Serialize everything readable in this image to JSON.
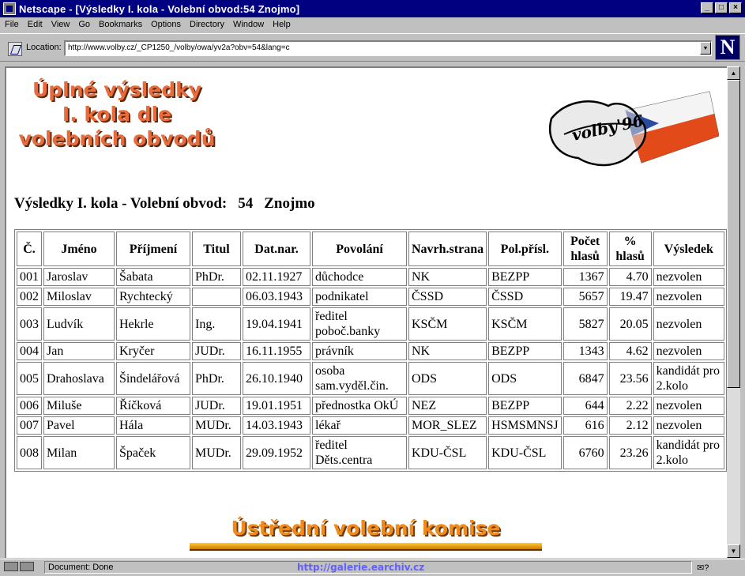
{
  "window": {
    "title": "Netscape - [Výsledky I. kola - Volební obvod:54 Znojmo]",
    "buttons": [
      "_",
      "□",
      "×"
    ]
  },
  "menu": [
    "File",
    "Edit",
    "View",
    "Go",
    "Bookmarks",
    "Options",
    "Directory",
    "Window",
    "Help"
  ],
  "location": {
    "label": "Location:",
    "url": "http://www.volby.cz/_CP1250_/volby/owa/yv2a?obv=54&lang=c"
  },
  "page": {
    "heading_lines": [
      "Úplné výsledky",
      "I. kola dle",
      "volebních obvodů"
    ],
    "logo_text": "volby'96",
    "subhead": {
      "label": "Výsledky I. kola - Volební obvod:",
      "number": "54",
      "name": "Znojmo"
    },
    "table": {
      "headers": [
        "Č.",
        "Jméno",
        "Příjmení",
        "Titul",
        "Dat.nar.",
        "Povolání",
        "Navrh.strana",
        "Pol.přísl.",
        "Počet hlasů",
        "% hlasů",
        "Výsledek"
      ],
      "rows": [
        [
          "001",
          "Jaroslav",
          "Šabata",
          "PhDr.",
          "02.11.1927",
          "důchodce",
          "NK",
          "BEZPP",
          "1367",
          "4.70",
          "nezvolen"
        ],
        [
          "002",
          "Miloslav",
          "Rychtecký",
          "",
          "06.03.1943",
          "podnikatel",
          "ČSSD",
          "ČSSD",
          "5657",
          "19.47",
          "nezvolen"
        ],
        [
          "003",
          "Ludvík",
          "Hekrle",
          "Ing.",
          "19.04.1941",
          "ředitel poboč.banky",
          "KSČM",
          "KSČM",
          "5827",
          "20.05",
          "nezvolen"
        ],
        [
          "004",
          "Jan",
          "Kryčer",
          "JUDr.",
          "16.11.1955",
          "právník",
          "NK",
          "BEZPP",
          "1343",
          "4.62",
          "nezvolen"
        ],
        [
          "005",
          "Drahoslava",
          "Šindelářová",
          "PhDr.",
          "26.10.1940",
          "osoba sam.vyděl.čin.",
          "ODS",
          "ODS",
          "6847",
          "23.56",
          "kandidát pro 2.kolo"
        ],
        [
          "006",
          "Miluše",
          "Říčková",
          "JUDr.",
          "19.01.1951",
          "přednostka OkÚ",
          "NEZ",
          "BEZPP",
          "644",
          "2.22",
          "nezvolen"
        ],
        [
          "007",
          "Pavel",
          "Hála",
          "MUDr.",
          "14.03.1943",
          "lékař",
          "MOR_SLEZ",
          "HSMSMNSJ",
          "616",
          "2.12",
          "nezvolen"
        ],
        [
          "008",
          "Milan",
          "Špaček",
          "MUDr.",
          "29.09.1952",
          "ředitel Děts.centra",
          "KDU-ČSL",
          "KDU-ČSL",
          "6760",
          "23.26",
          "kandidát pro 2.kolo"
        ]
      ]
    },
    "footer_banner": "Ústřední volební komise"
  },
  "status": {
    "text": "Document: Done",
    "watermark": "http://galerie.earchiv.cz"
  },
  "colors": {
    "titlebar": "#000080",
    "chrome": "#c0c0c0",
    "heading": "#e96a3a",
    "banner": "#f08a1a"
  }
}
